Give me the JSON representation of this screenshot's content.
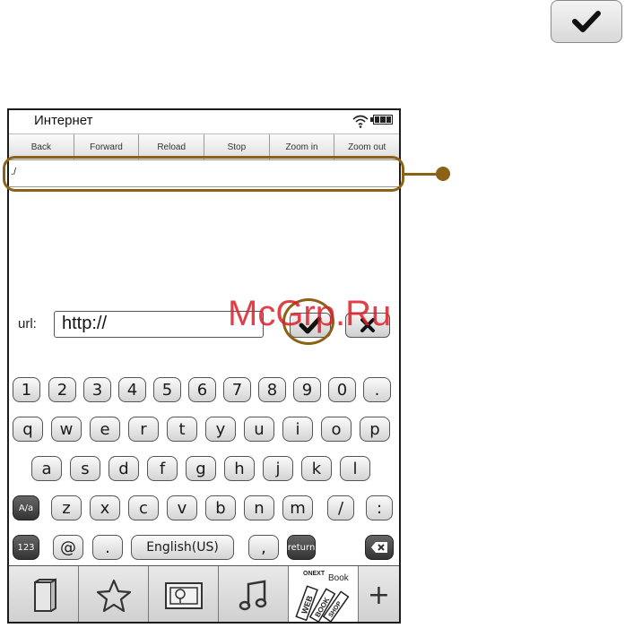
{
  "app": {
    "title": "Интернет"
  },
  "toolbar": [
    "Back",
    "Forward",
    "Reload",
    "Stop",
    "Zoom in",
    "Zoom out"
  ],
  "address": {
    "value": "./"
  },
  "url_bar": {
    "label": "url:",
    "value": "http://"
  },
  "keyboard": {
    "row1": [
      "1",
      "2",
      "3",
      "4",
      "5",
      "6",
      "7",
      "8",
      "9",
      "0",
      "."
    ],
    "row2": [
      "q",
      "w",
      "e",
      "r",
      "t",
      "y",
      "u",
      "i",
      "o",
      "p"
    ],
    "row3": [
      "a",
      "s",
      "d",
      "f",
      "g",
      "h",
      "j",
      "k",
      "l"
    ],
    "row4": [
      "A/a",
      "z",
      "x",
      "c",
      "v",
      "b",
      "n",
      "m",
      "/",
      ":"
    ],
    "row5": {
      "num": "123",
      "at": "@",
      "dot": ".",
      "lang": "English(US)",
      "comma": ",",
      "return": "return"
    }
  },
  "tabs": [
    "book-icon",
    "star-icon",
    "picture-icon",
    "music-icon",
    "webbook-icon",
    "plus"
  ],
  "webbook": {
    "line1": "ONEXT",
    "line2": "Book",
    "line3": "WEB",
    "line4": "BOOK",
    "line5": "SHOP"
  },
  "plus_label": "+",
  "watermark": "McGrp.Ru",
  "colors": {
    "callout": "#8b6216",
    "watermark": "#dc1e28"
  }
}
